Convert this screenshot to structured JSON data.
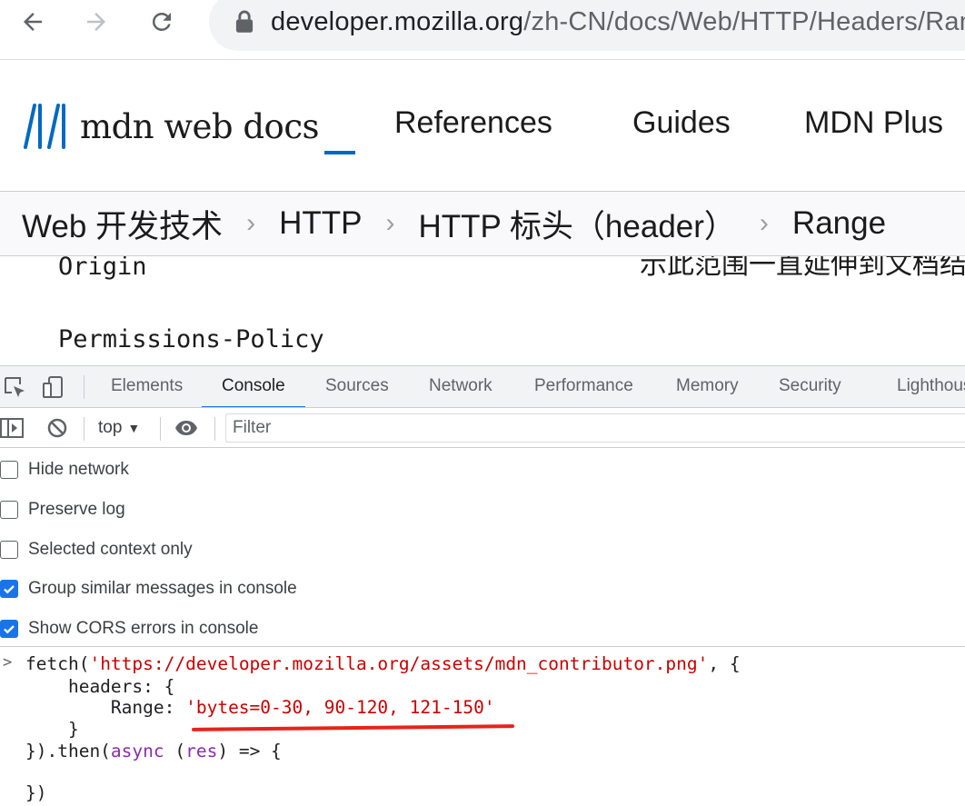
{
  "browser": {
    "url_host": "developer.mozilla.org",
    "url_path": "/zh-CN/docs/Web/HTTP/Headers/Range"
  },
  "mdn": {
    "logo_text": "mdn web docs",
    "nav": [
      "References",
      "Guides",
      "MDN Plus"
    ]
  },
  "breadcrumb": [
    "Web 开发技术",
    "HTTP",
    "HTTP 标头（header）",
    "Range"
  ],
  "content": {
    "items": [
      "Origin",
      "Permissions-Policy"
    ],
    "cut_text": "示此范围一直延伸到文档结束"
  },
  "devtools": {
    "tabs": [
      "Elements",
      "Console",
      "Sources",
      "Network",
      "Performance",
      "Memory",
      "Security",
      "Lighthouse"
    ],
    "active_tab": "Console",
    "context": "top",
    "filter_placeholder": "Filter",
    "settings": [
      {
        "label": "Hide network",
        "checked": false
      },
      {
        "label": "Preserve log",
        "checked": false
      },
      {
        "label": "Selected context only",
        "checked": false
      },
      {
        "label": "Group similar messages in console",
        "checked": true
      },
      {
        "label": "Show CORS errors in console",
        "checked": true
      }
    ],
    "console": {
      "prompt": ">",
      "l1_pre": "fetch(",
      "l1_str": "'https://developer.mozilla.org/assets/mdn_contributor.png'",
      "l1_post": ", {",
      "l2": "    headers: {",
      "l3_pre": "        Range: ",
      "l3_str": "'bytes=0-30, 90-120, 121-150'",
      "l4": "    }",
      "l5_pre": "}).then(",
      "l5_kw": "async",
      "l5_mid": " (",
      "l5_arg": "res",
      "l5_post": ") => {",
      "l6": "})"
    }
  },
  "colors": {
    "accent": "#1a73e8",
    "mdn_blue": "#0069c2",
    "string": "#c80000",
    "keyword": "#8a2dad",
    "annotation": "#e8231b"
  }
}
